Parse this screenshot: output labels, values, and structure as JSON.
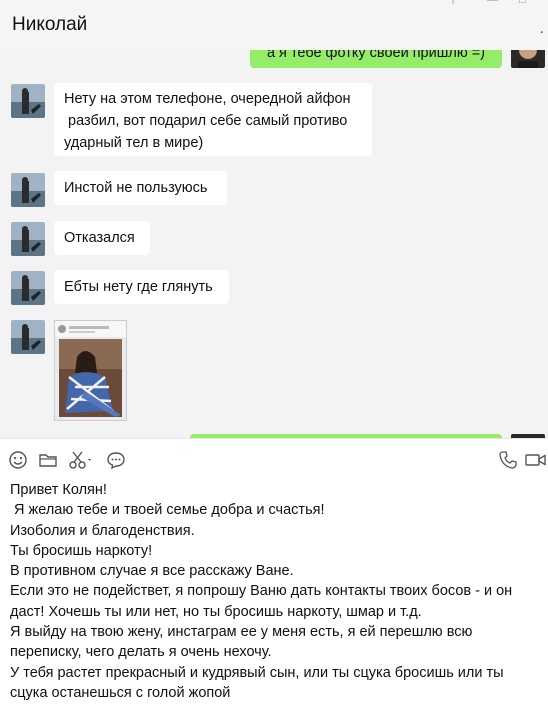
{
  "header": {
    "title": "Николай",
    "menu_glyph": "."
  },
  "chat": {
    "top_partial_message": "а я тебе фотку своей пришлю =)",
    "messages": [
      {
        "text": "Нету на этом телефоне, очередной айфон\n разбил, вот подарил себе самый противо\nударный тел в мире)"
      },
      {
        "text": "Инстой не пользуюсь"
      },
      {
        "text": "Отказался"
      },
      {
        "text": "Ебты нету где глянуть"
      }
    ]
  },
  "toolbar": {
    "left_icons": [
      "emoji-icon",
      "folder-icon",
      "scissors-icon",
      "chat-bubble-icon"
    ],
    "right_icons": [
      "phone-icon",
      "video-icon"
    ]
  },
  "input": {
    "lines": [
      "Привет Колян!",
      " Я желаю тебе и твоей семье добра и счастья!",
      "Изоболия и благоденствия.",
      "Ты бросишь наркоту!",
      "В противном случае я все расскажу Ване.",
      "Если это не подействет, я попрошу Ваню дать контакты твоих босов - и он",
      "даст! Хочешь ты или нет, но ты бросишь наркоту, шмар и т.д.",
      "Я выйду на твою жену, инстаграм ее у меня есть, я ей перешлю всю",
      "переписку, чего делать я очень нехочу.",
      "У тебя растет прекрасный и кудрявый сын, или ты сцука бросишь или ты",
      "сцука останешься с голой жопой"
    ]
  },
  "colors": {
    "my_bubble": "#95ec69",
    "their_bubble": "#ffffff",
    "chat_bg": "#f3f3f3"
  }
}
